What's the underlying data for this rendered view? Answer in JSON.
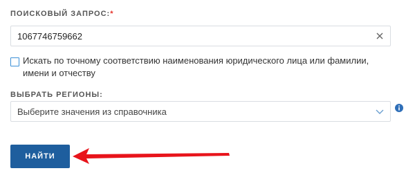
{
  "search": {
    "label": "ПОИСКОВЫЙ ЗАПРОС:",
    "required_mark": "*",
    "value": "1067746759662"
  },
  "exact_match": {
    "checked": false,
    "label_line1": "Искать по точному соответствию наименования юридического лица или фамилии,",
    "label_line2": "имени и отчеству"
  },
  "regions": {
    "label": "ВЫБРАТЬ РЕГИОНЫ:",
    "placeholder": "Выберите значения из справочника"
  },
  "submit": {
    "label": "НАЙТИ"
  },
  "colors": {
    "accent": "#1e5e9e",
    "required": "#e5332a",
    "arrow": "#e8141b",
    "checkbox_border": "#3a8fd6"
  },
  "icons": {
    "clear": "close-icon",
    "dropdown": "chevron-down-icon",
    "info": "info-icon",
    "annotation": "arrow-left-icon"
  }
}
